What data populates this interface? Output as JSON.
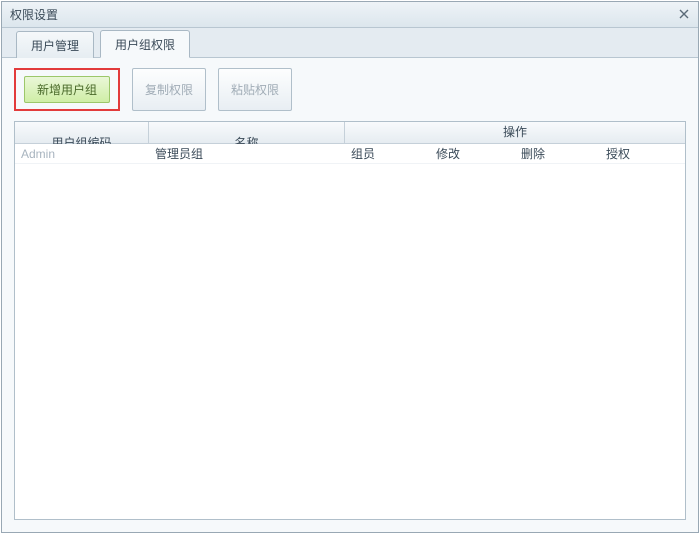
{
  "window": {
    "title": "权限设置"
  },
  "tabs": {
    "user_mgmt": "用户管理",
    "group_perm": "用户组权限"
  },
  "toolbar": {
    "add_group": "新增用户组",
    "copy_perm": "复制权限",
    "paste_perm": "粘贴权限"
  },
  "table": {
    "headers": {
      "code": "用户组编码",
      "name": "名称",
      "ops": "操作"
    },
    "op_cols": {
      "members": "组员",
      "edit": "修改",
      "delete": "删除",
      "auth": "授权"
    },
    "rows": [
      {
        "code": "Admin",
        "name": "管理员组",
        "members": "组员",
        "edit": "修改",
        "delete": "删除",
        "auth": "授权"
      }
    ]
  }
}
